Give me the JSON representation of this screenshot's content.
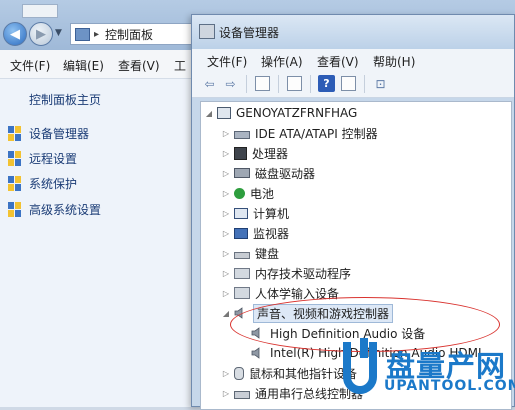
{
  "control_panel": {
    "address_segment": "控制面板",
    "menu": [
      "文件(F)",
      "编辑(E)",
      "查看(V)",
      "工"
    ],
    "home_link": "控制面板主页",
    "links": [
      "设备管理器",
      "远程设置",
      "系统保护",
      "高级系统设置"
    ]
  },
  "device_manager": {
    "title": "设备管理器",
    "menu": [
      "文件(F)",
      "操作(A)",
      "查看(V)",
      "帮助(H)"
    ],
    "toolbar_icons": [
      "back-arrow-icon",
      "forward-arrow-icon",
      "properties-icon",
      "tree-view-icon",
      "help-icon",
      "details-icon",
      "scan-hardware-icon"
    ],
    "root": "GENOYATZFRNFHAG",
    "categories": [
      {
        "label": "IDE ATA/ATAPI 控制器",
        "icon": "ide-controller-icon",
        "expanded": false
      },
      {
        "label": "处理器",
        "icon": "processor-icon",
        "expanded": false
      },
      {
        "label": "磁盘驱动器",
        "icon": "disk-drive-icon",
        "expanded": false
      },
      {
        "label": "电池",
        "icon": "battery-icon",
        "expanded": false
      },
      {
        "label": "计算机",
        "icon": "computer-icon",
        "expanded": false
      },
      {
        "label": "监视器",
        "icon": "monitor-icon",
        "expanded": false
      },
      {
        "label": "键盘",
        "icon": "keyboard-icon",
        "expanded": false
      },
      {
        "label": "内存技术驱动程序",
        "icon": "memory-tech-icon",
        "expanded": false
      },
      {
        "label": "人体学输入设备",
        "icon": "hid-icon",
        "expanded": false
      },
      {
        "label": "声音、视频和游戏控制器",
        "icon": "sound-icon",
        "expanded": true
      }
    ],
    "sound_children": [
      "High Definition Audio 设备",
      "Intel(R) High Definition Audio HDMI"
    ],
    "after_categories": [
      "鼠标和其他指针设备",
      "通用串行总线控制器"
    ]
  },
  "watermark": {
    "brand": "盘量产网",
    "site": "UPANTOOL.COM"
  },
  "colors": {
    "annotation_ellipse": "#d9332f",
    "watermark": "#1b79c9",
    "selection": "#dde8f6"
  }
}
